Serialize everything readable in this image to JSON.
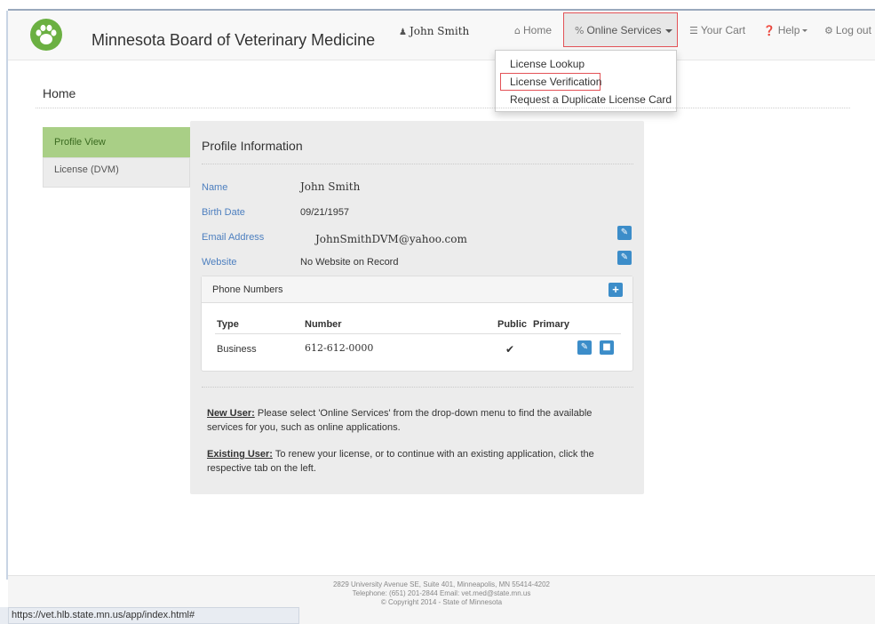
{
  "header": {
    "brand": "Minnesota Board of Veterinary Medicine",
    "user": "John Smith",
    "nav": {
      "home": "Home",
      "online_services": "Online Services",
      "cart": "Your Cart",
      "help": "Help",
      "logout": "Log out"
    },
    "icons": {
      "user": "user-icon",
      "home": "home-icon",
      "services": "link-icon",
      "cart": "cart-icon",
      "help": "question-circle-icon",
      "logout": "gear-icon"
    }
  },
  "dropdown": {
    "items": [
      "License Lookup",
      "License Verification",
      "Request a Duplicate License Card"
    ]
  },
  "page": {
    "title": "Home"
  },
  "tabs": [
    "Profile View",
    "License (DVM)"
  ],
  "profile": {
    "title": "Profile Information",
    "fields": {
      "name_label": "Name",
      "name_value": "John Smith",
      "birth_label": "Birth Date",
      "birth_value": "09/21/1957",
      "email_label": "Email Address",
      "email_value": "JohnSmithDVM@yahoo.com",
      "website_label": "Website",
      "website_value": "No Website on Record"
    },
    "phones": {
      "title": "Phone Numbers",
      "columns": [
        "Type",
        "Number",
        "Public",
        "Primary"
      ],
      "rows": [
        {
          "type": "Business",
          "number": "612-612-0000",
          "public": "✔",
          "primary": ""
        }
      ]
    },
    "notes": {
      "new_user_label": "New User:",
      "new_user_text": " Please select 'Online Services' from the drop-down menu to find the available services for you, such as online applications.",
      "existing_user_label": "Existing User:",
      "existing_user_text": " To renew your license, or to continue with an existing application, click the respective tab on the left."
    }
  },
  "footer": {
    "address": "2829 University Avenue SE, Suite 401, Minneapolis, MN 55414-4202",
    "contact": "Telephone: (651) 201-2844  Email: vet.med@state.mn.us",
    "copyright": "© Copyright 2014 - State of Minnesota"
  },
  "statusbar": {
    "url": "https://vet.hlb.state.mn.us/app/index.html#"
  },
  "colors": {
    "accent": "#3c8dc9",
    "active_tab": "#a9cf86",
    "highlight_border": "#e35257",
    "logo": "#6bb042",
    "label_blue": "#4d7fbf"
  }
}
